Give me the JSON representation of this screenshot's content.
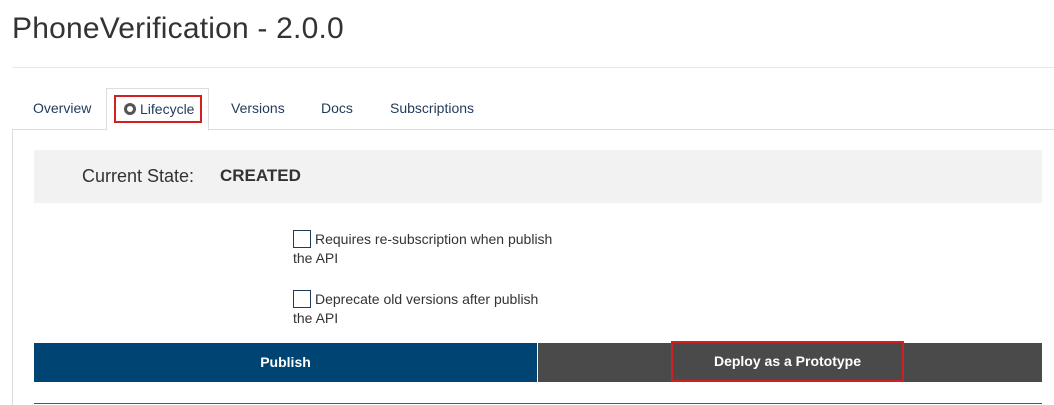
{
  "page": {
    "title": "PhoneVerification - 2.0.0"
  },
  "tabs": {
    "overview": "Overview",
    "lifecycle": "Lifecycle",
    "versions": "Versions",
    "docs": "Docs",
    "subscriptions": "Subscriptions",
    "active": "Lifecycle"
  },
  "state": {
    "label": "Current State:",
    "value": "CREATED"
  },
  "options": {
    "require_resubscription": "Requires re-subscription when publish the API",
    "deprecate_old": "Deprecate old versions after publish the API"
  },
  "actions": {
    "publish": "Publish",
    "deploy_prototype": "Deploy as a Prototype"
  },
  "colors": {
    "publish_bg": "#004474",
    "deploy_bg": "#4a4a4a",
    "highlight": "#d21f1f"
  }
}
